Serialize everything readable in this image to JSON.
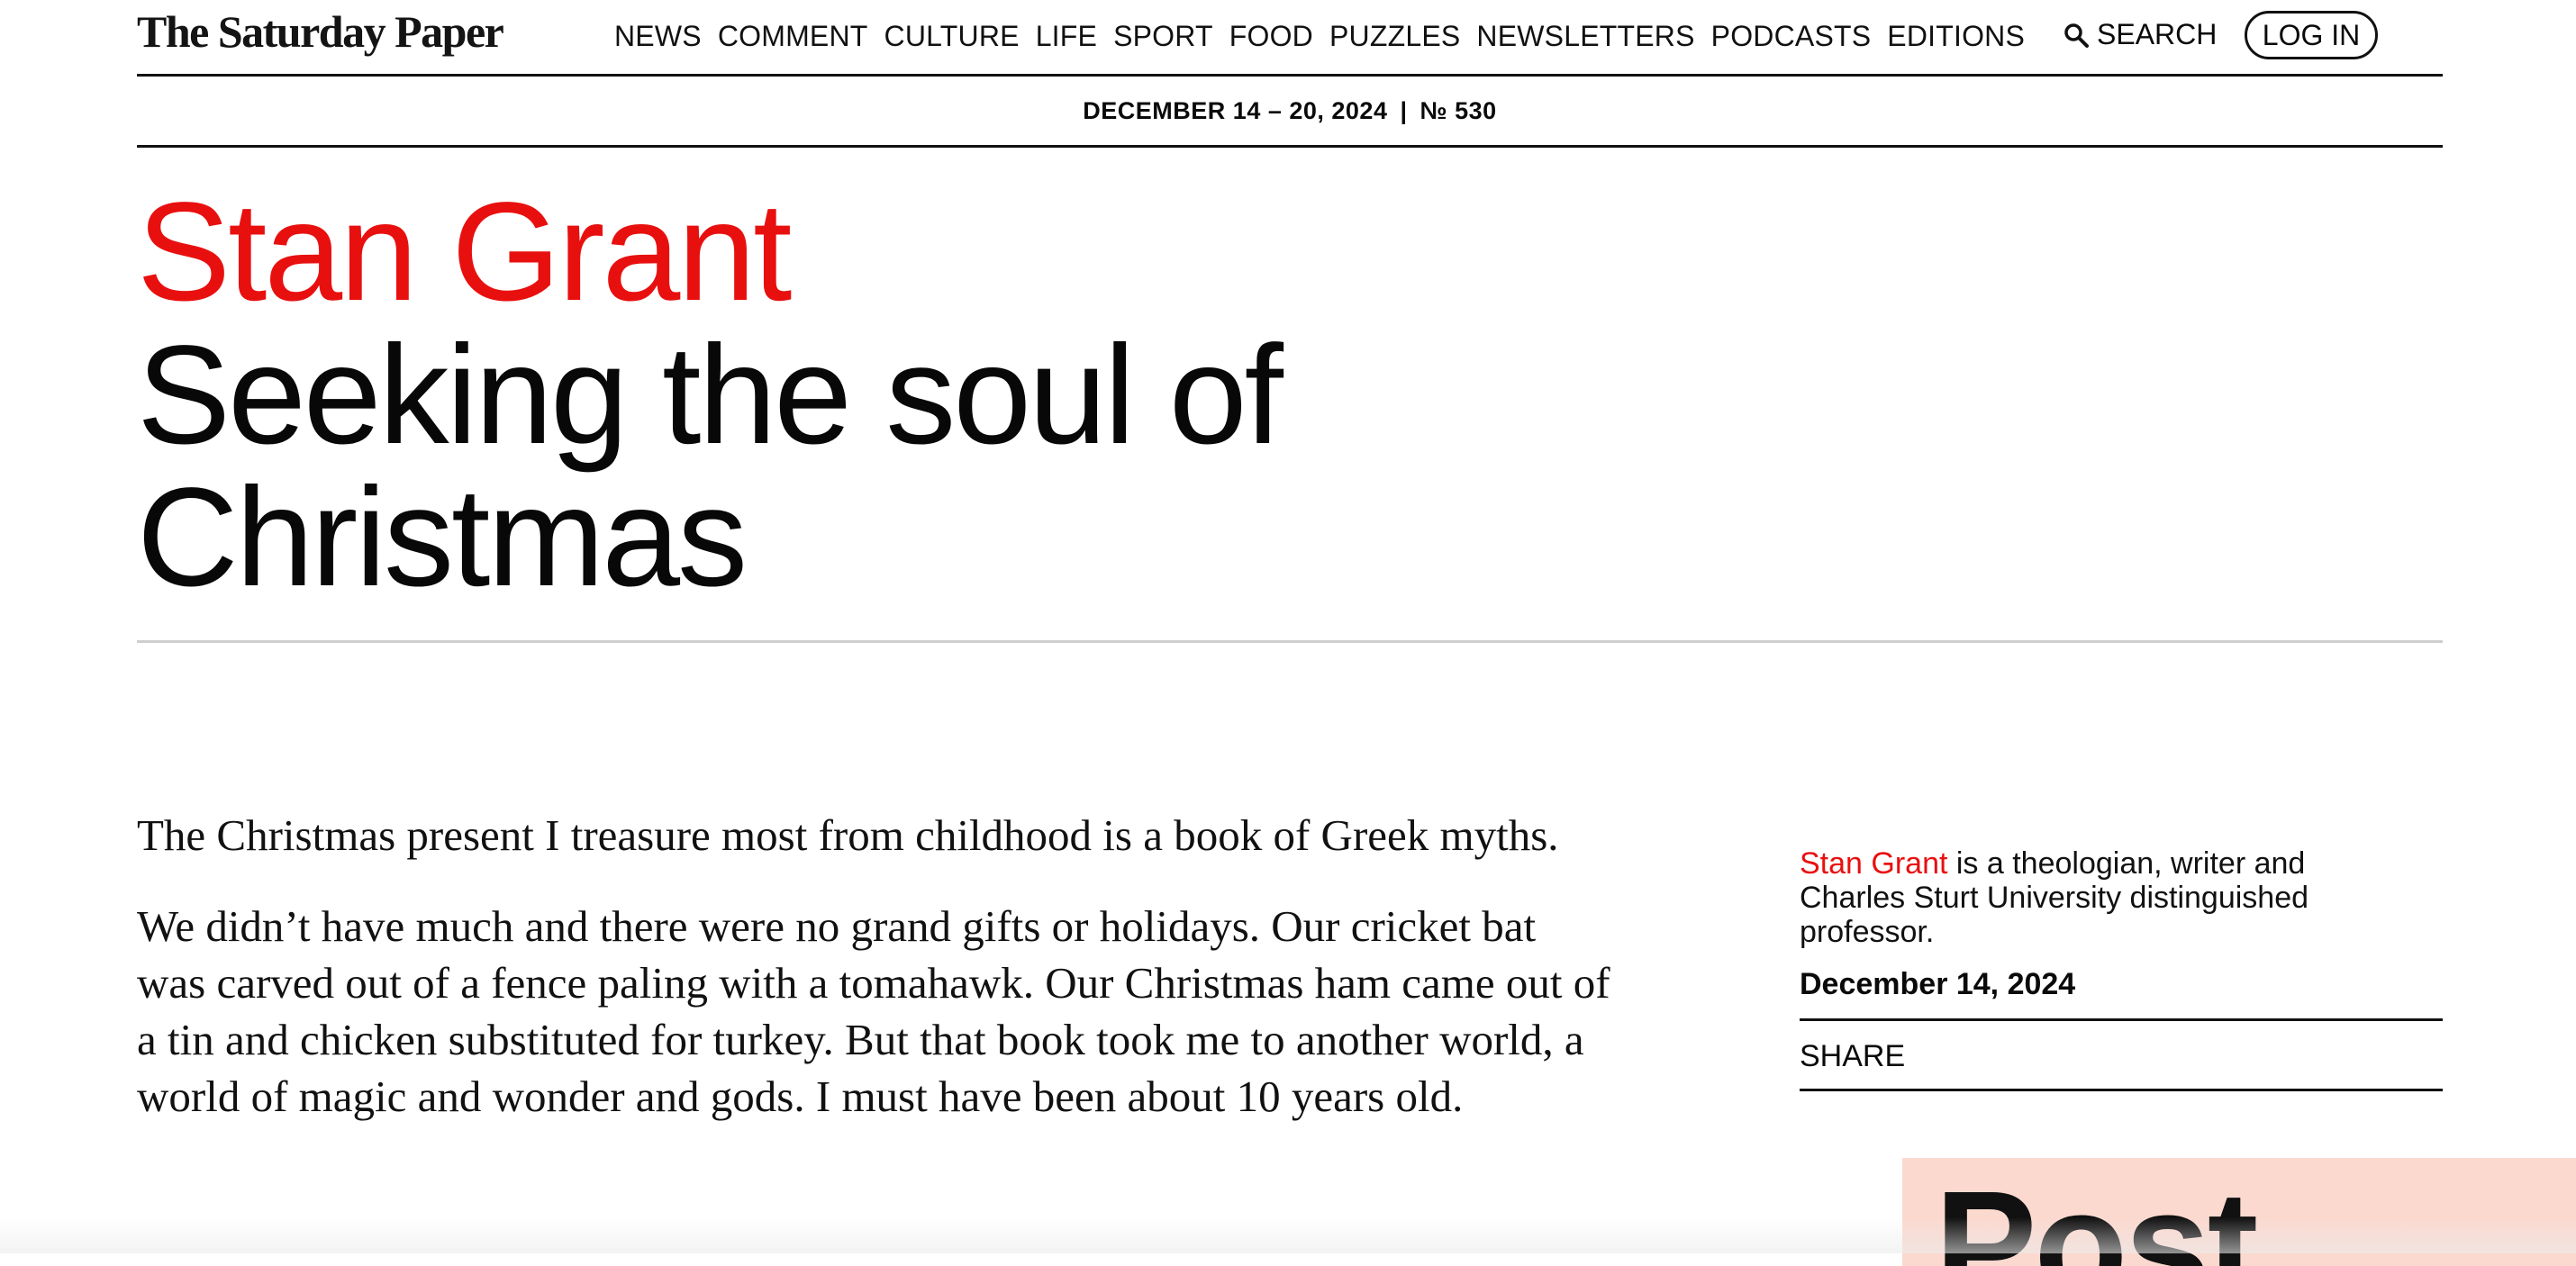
{
  "site": {
    "logo_text": "The Saturday Paper"
  },
  "nav": {
    "items": [
      {
        "label": "NEWS"
      },
      {
        "label": "COMMENT"
      },
      {
        "label": "CULTURE"
      },
      {
        "label": "LIFE"
      },
      {
        "label": "SPORT"
      },
      {
        "label": "FOOD"
      },
      {
        "label": "PUZZLES"
      },
      {
        "label": "NEWSLETTERS"
      },
      {
        "label": "PODCASTS"
      },
      {
        "label": "EDITIONS"
      }
    ],
    "search_label": "SEARCH",
    "search_icon": "search-icon",
    "login_label": "LOG IN"
  },
  "issue": {
    "dates": "DECEMBER 14 – 20, 2024",
    "separator": "|",
    "number": "№ 530"
  },
  "article": {
    "author": "Stan Grant",
    "title": "Seeking the soul of Christmas",
    "paragraphs": [
      "The Christmas present I treasure most from childhood is a book of Greek myths.",
      "We didn’t have much and there were no grand gifts or holidays. Our cricket bat was carved out of a fence paling with a tomahawk. Our Christmas ham came out of a tin and chicken substituted for turkey. But that book took me to another world, a world of magic and wonder and gods. I must have been about 10 years old."
    ]
  },
  "sidebar": {
    "author_name": "Stan Grant",
    "author_bio": " is a theologian, writer and Charles Sturt University distinguished professor.",
    "date": "December 14, 2024",
    "share_label": "SHARE"
  },
  "promo": {
    "text": "Post"
  },
  "colors": {
    "accent": "#e8100f",
    "promo_bg": "#fbd9cf"
  }
}
